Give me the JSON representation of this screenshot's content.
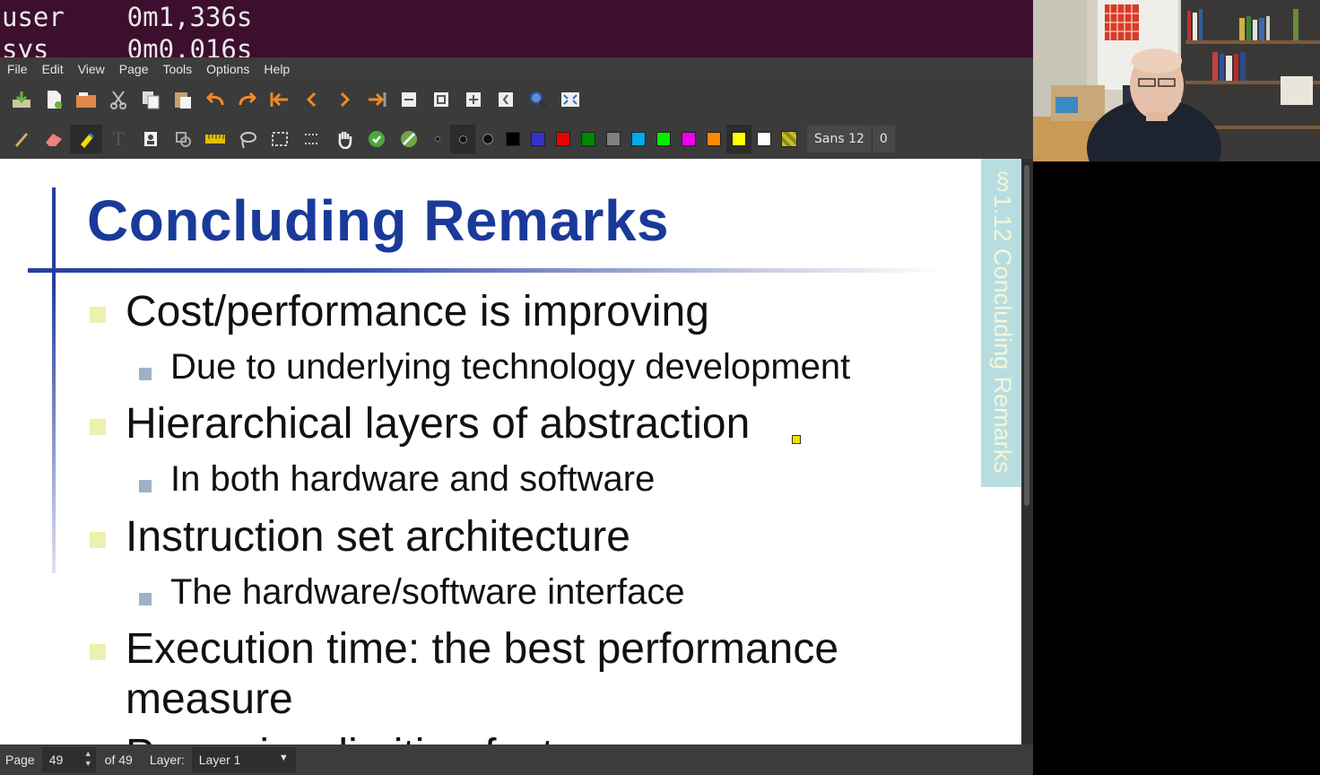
{
  "terminal": {
    "line1": "user    0m1,336s",
    "line2": "sys     0m0,016s"
  },
  "menu": [
    "File",
    "Edit",
    "View",
    "Page",
    "Tools",
    "Options",
    "Help"
  ],
  "toolbar": {
    "font": "Sans 12",
    "line_width": "0",
    "colors": [
      "#000000",
      "#3333cc",
      "#ee0000",
      "#008800",
      "#808080",
      "#00aaee",
      "#00ee00",
      "#ee00ee",
      "#ff8800",
      "#ffff00",
      "#ffffff"
    ]
  },
  "slide": {
    "title": "Concluding Remarks",
    "section": "§1.12 Concluding Remarks",
    "bullets": [
      {
        "text": "Cost/performance is improving",
        "sub": "Due to underlying technology development"
      },
      {
        "text": "Hierarchical layers of abstraction",
        "sub": "In both hardware and software"
      },
      {
        "text": "Instruction set architecture",
        "sub": "The hardware/software interface"
      },
      {
        "text": "Execution time: the best performance",
        "text2": "measure"
      },
      {
        "text": "Power is a limiting factor"
      }
    ]
  },
  "status": {
    "page_label": "Page",
    "page_value": "49",
    "page_total": "of 49",
    "layer_label": "Layer:",
    "layer_value": "Layer 1"
  }
}
